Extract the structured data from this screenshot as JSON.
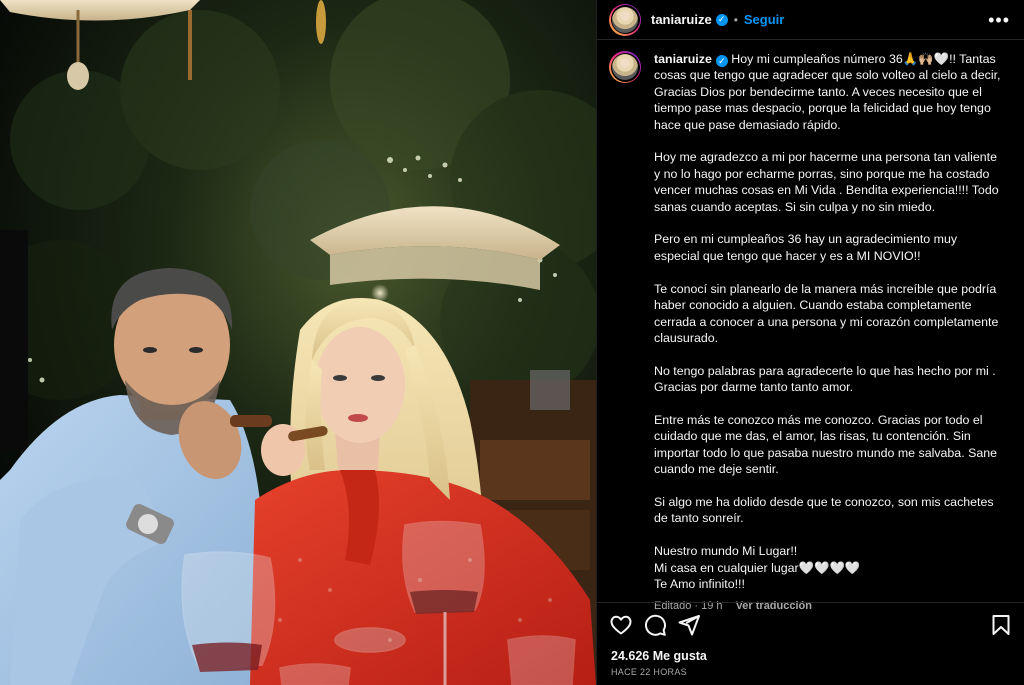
{
  "post": {
    "username": "taniaruize",
    "verified": true,
    "separator": "•",
    "follow_label": "Seguir",
    "more_label": "•••",
    "caption": "Hoy mi cumpleaños número 36🙏🙌🏼🤍!! Tantas cosas que tengo que agradecer que solo volteo al cielo a decir, Gracias Dios por bendecirme tanto. A veces necesito que el tiempo pase mas despacio, porque la felicidad que hoy tengo hace que pase demasiado rápido.\n\nHoy me agradezco a mi por hacerme una persona tan valiente y no lo hago por echarme porras, sino porque me ha costado vencer muchas cosas en Mi Vida . Bendita experiencia!!!! Todo sanas cuando aceptas. Si sin culpa y no sin miedo.\n\nPero en mi cumpleaños 36 hay un agradecimiento muy especial que tengo que hacer y es a MI NOVIO!!\n\nTe conocí sin planearlo de la manera más increíble que podría haber conocido a alguien. Cuando estaba completamente cerrada a conocer a una persona y mi corazón completamente clausurado.\n\nNo tengo palabras para agradecerte lo que has hecho por mi . Gracias por darme tanto tanto amor.\n\nEntre más te conozco más me conozco. Gracias por todo el cuidado que me das, el amor, las risas, tu contención. Sin importar todo lo que pasaba nuestro mundo me salvaba. Sane cuando me deje sentir.\n\nSi algo me ha dolido desde que te conozco, son mis cachetes de tanto sonreír.\n\nNuestro mundo Mi Lugar!!\nMi casa en cualquier lugar🤍🤍🤍🤍\nTe Amo infinito!!!",
    "edited_label": "Editado · 19 h",
    "translate_label": "Ver traducción",
    "likes_label": "24.626 Me gusta",
    "time_label": "HACE 22 HORAS"
  },
  "icons": {
    "like": "heart-icon",
    "comment": "comment-icon",
    "share": "share-icon",
    "save": "bookmark-icon"
  },
  "colors": {
    "background": "#000000",
    "link": "#0095f6",
    "muted": "#a8a8a8",
    "text": "#f5f5f5"
  }
}
